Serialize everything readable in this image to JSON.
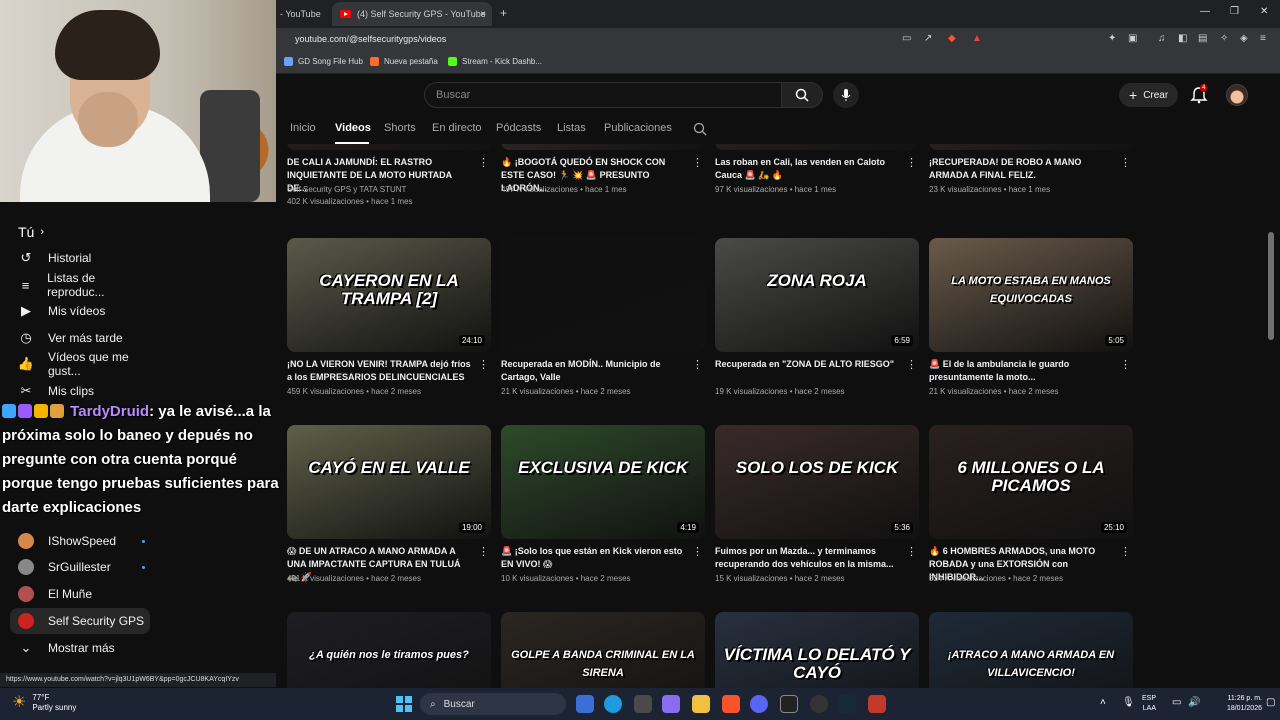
{
  "browser": {
    "tabs": [
      {
        "label": "- YouTube"
      },
      {
        "label": "(4) Self Security GPS - YouTube"
      }
    ],
    "url": "youtube.com/@selfsecuritygps/videos",
    "bookmarks": [
      {
        "label": "GD Song File Hub",
        "color": "#6aa2ff"
      },
      {
        "label": "Nueva pestaña",
        "color": "#ff6b2b"
      },
      {
        "label": "Stream - Kick Dashb...",
        "color": "#53fc18"
      }
    ],
    "status_url": "https://www.youtube.com/watch?v=jlq3U1pW6BY&pp=0gcJCU8KAYcqIYzv"
  },
  "header": {
    "search_placeholder": "Buscar",
    "create_label": "Crear",
    "notification_count": "4"
  },
  "channel_tabs": [
    "Inicio",
    "Videos",
    "Shorts",
    "En directo",
    "Pódcasts",
    "Listas",
    "Publicaciones"
  ],
  "sidebar": {
    "section_title": "Tú",
    "items": [
      {
        "label": "Historial",
        "icon": "history-icon",
        "glyph": "↺"
      },
      {
        "label": "Listas de reproduc...",
        "icon": "playlist-icon",
        "glyph": "≡"
      },
      {
        "label": "Mis vídeos",
        "icon": "my-videos-icon",
        "glyph": "▶"
      },
      {
        "label": "Ver más tarde",
        "icon": "watch-later-icon",
        "glyph": "◷"
      },
      {
        "label": "Vídeos que me gust...",
        "icon": "like-icon",
        "glyph": "👍"
      },
      {
        "label": "Mis clips",
        "icon": "clips-icon",
        "glyph": "✂"
      }
    ],
    "subscriptions": [
      {
        "label": "IShowSpeed",
        "color": "#d4884a"
      },
      {
        "label": "SrGuillester",
        "color": "#888888"
      },
      {
        "label": "El Muñe",
        "color": "#b05050"
      },
      {
        "label": "Self Security GPS",
        "color": "#cc2222"
      }
    ],
    "show_more": "Mostrar más"
  },
  "chat": {
    "user": "TardyDruid",
    "message": ": ya le avisé...a la próxima solo lo baneo y depués no pregunte con otra cuenta porqué porque tengo pruebas suficientes para darte explicaciones"
  },
  "videos": [
    {
      "title": "DE CALI A JAMUNDÍ: EL RASTRO INQUIETANTE DE LA MOTO HURTADA DE...",
      "meta1": "Self Security GPS y TATA STUNT",
      "meta2": "402 K visualizaciones • hace 1 mes",
      "duration": "",
      "overlay": "",
      "bg": "#3a2e28"
    },
    {
      "title": "🔥 ¡BOGOTÁ QUEDÓ EN SHOCK CON ESTE CASO! 🏃 💥 🚨 PRESUNTO LADRÓN...",
      "meta1": "",
      "meta2": "497 K visualizaciones • hace 1 mes",
      "duration": "",
      "overlay": "",
      "bg": "#4a4038"
    },
    {
      "title": "Las roban en Cali, las venden en Caloto Cauca 🚨 🛵 🔥",
      "meta1": "",
      "meta2": "97 K visualizaciones • hace 1 mes",
      "duration": "",
      "overlay": "",
      "bg": "#3e3428"
    },
    {
      "title": "¡RECUPERADA! DE ROBO A MANO ARMADA A FINAL FELIZ.",
      "meta1": "",
      "meta2": "23 K visualizaciones • hace 1 mes",
      "duration": "",
      "overlay": "",
      "bg": "#403630"
    },
    {
      "title": "¡NO LA VIERON VENIR! TRAMPA dejó fríos a los EMPRESARIOS DELINCUENCIALES",
      "meta1": "",
      "meta2": "459 K visualizaciones • hace 2 meses",
      "duration": "24:10",
      "overlay": "CAYERON EN LA TRAMPA [2]",
      "bg": "#5a5a4a"
    },
    {
      "title": "Recuperada en MODÍN.. Municipio de Cartago, Valle",
      "meta1": "",
      "meta2": "21 K visualizaciones • hace 2 meses",
      "duration": "",
      "overlay": "",
      "bg": "#101010"
    },
    {
      "title": "Recuperada en \"ZONA DE ALTO RIESGO\"",
      "meta1": "",
      "meta2": "19 K visualizaciones • hace 2 meses",
      "duration": "6:59",
      "overlay": "ZONA ROJA",
      "bg": "#4a4a48"
    },
    {
      "title": "🚨 El de la ambulancia le guardo presuntamente la moto...",
      "meta1": "",
      "meta2": "21 K visualizaciones • hace 2 meses",
      "duration": "5:05",
      "overlay": "LA MOTO ESTABA EN MANOS EQUIVOCADAS",
      "bg": "#6a5a4a"
    },
    {
      "title": "😱 DE UN ATRACO A MANO ARMADA A UNA IMPACTANTE CAPTURA EN TULUÁ 🚓 🚀",
      "meta1": "",
      "meta2": "401 K visualizaciones • hace 2 meses",
      "duration": "19:00",
      "overlay": "CAYÓ EN EL VALLE",
      "bg": "#5e6048"
    },
    {
      "title": "🚨 ¡Solo los que están en Kick vieron esto EN VIVO! 😱",
      "meta1": "",
      "meta2": "10 K visualizaciones • hace 2 meses",
      "duration": "4:19",
      "overlay": "EXCLUSIVA DE KICK",
      "bg": "#2e4a2a"
    },
    {
      "title": "Fuimos por un Mazda... y terminamos recuperando dos vehículos en la misma...",
      "meta1": "",
      "meta2": "15 K visualizaciones • hace 2 meses",
      "duration": "5:36",
      "overlay": "SOLO LOS DE KICK",
      "bg": "#3a2a2a"
    },
    {
      "title": "🔥 6 HOMBRES ARMADOS, una MOTO ROBADA y una EXTORSIÓN con INHIBIDOR...",
      "meta1": "",
      "meta2": "324 K visualizaciones • hace 2 meses",
      "duration": "25:10",
      "overlay": "6 MILLONES O LA PICAMOS",
      "bg": "#2a2020"
    },
    {
      "title": "",
      "meta1": "",
      "meta2": "",
      "duration": "",
      "overlay": "¿A quién nos le tiramos pues?",
      "bg": "#1e1e22"
    },
    {
      "title": "",
      "meta1": "",
      "meta2": "",
      "duration": "",
      "overlay": "GOLPE A BANDA CRIMINAL EN LA SIRENA",
      "bg": "#2a2622"
    },
    {
      "title": "",
      "meta1": "",
      "meta2": "",
      "duration": "",
      "overlay": "VÍCTIMA LO DELATÓ Y CAYÓ",
      "bg": "#283040"
    },
    {
      "title": "",
      "meta1": "",
      "meta2": "",
      "duration": "",
      "overlay": "¡ATRACO A MANO ARMADA EN VILLAVICENCIO!",
      "bg": "#1e2a38"
    }
  ],
  "taskbar": {
    "temp": "77°F",
    "weather": "Partly sunny",
    "search": "Buscar",
    "lang1": "ESP",
    "lang2": "LAA",
    "time": "11:26 p. m.",
    "date": "18/01/2026"
  }
}
